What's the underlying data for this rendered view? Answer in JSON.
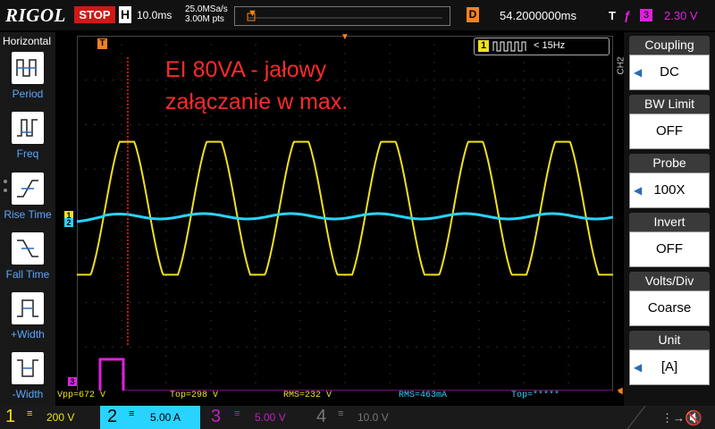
{
  "topbar": {
    "brand": "RIGOL",
    "run_state": "STOP",
    "horizontal_label": "H",
    "timebase": "10.0ms",
    "sample_rate": "25.0MSa/s",
    "memory_depth": "3.00M pts",
    "delay_label": "D",
    "delay": "54.2000000ms",
    "trigger_label": "T",
    "trigger_source": "3",
    "trigger_level": "2.30 V"
  },
  "left_panel": {
    "title": "Horizontal",
    "buttons": [
      "Period",
      "Freq",
      "Rise Time",
      "Fall Time",
      "+Width",
      "-Width"
    ]
  },
  "screen": {
    "annotation_line1": "EI 80VA - jałowy",
    "annotation_line2": "załączanie w max.",
    "freq_badge_channel": "1",
    "freq_badge_text": "< 15Hz",
    "trigger_marker": "T",
    "ch1_marker": "1",
    "ch2_marker": "2",
    "ch3_marker": "3",
    "colors": {
      "ch1": "#f0e020",
      "ch2": "#29d3ff",
      "ch3": "#e020e0",
      "cursor": "#ff2020",
      "accent": "#f58220"
    }
  },
  "measurements": {
    "vpp": "Vpp=672 V",
    "top1": "Top=298 V",
    "rms1": "RMS=232 V",
    "rms2": "RMS=463mA",
    "top2": "Top=*****"
  },
  "right_panel": {
    "side_label": "CH2",
    "items": [
      {
        "title": "Coupling",
        "value": "DC"
      },
      {
        "title": "BW Limit",
        "value": "OFF"
      },
      {
        "title": "Probe",
        "value": "100X"
      },
      {
        "title": "Invert",
        "value": "OFF"
      },
      {
        "title": "Volts/Div",
        "value": "Coarse"
      },
      {
        "title": "Unit",
        "value": "[A]"
      }
    ]
  },
  "bottombar": {
    "ch1": {
      "num": "1",
      "scale": "200 V"
    },
    "ch2": {
      "num": "2",
      "scale": "5.00 A"
    },
    "ch3": {
      "num": "3",
      "scale": "5.00 V"
    },
    "ch4": {
      "num": "4",
      "scale": "10.0 V"
    }
  }
}
